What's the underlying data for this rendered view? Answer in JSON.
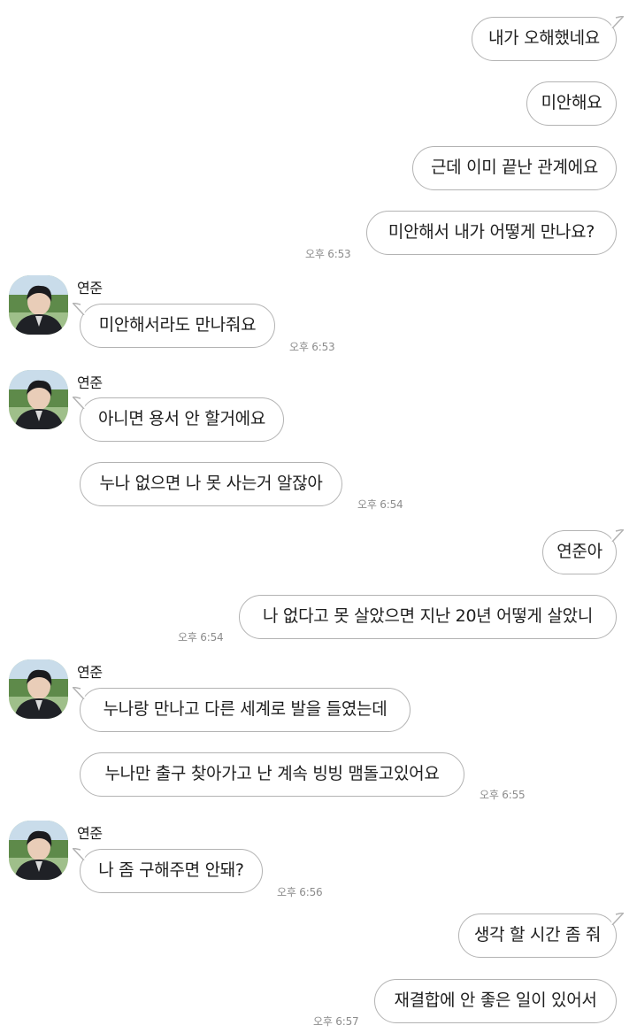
{
  "chat": {
    "sender_name": "연준",
    "messages": [
      {
        "text": "내가 오해했네요"
      },
      {
        "text": "미안해요"
      },
      {
        "text": "근데 이미 끝난 관계에요"
      },
      {
        "text": "미안해서 내가 어떻게 만나요?",
        "time": "오후 6:53"
      },
      {
        "text": "미안해서라도 만나줘요",
        "time": "오후 6:53"
      },
      {
        "text": "아니면 용서 안 할거에요"
      },
      {
        "text": "누나 없으면 나 못 사는거 알잖아",
        "time": "오후 6:54"
      },
      {
        "text": "연준아"
      },
      {
        "text": "나 없다고 못 살았으면 지난 20년 어떻게 살았니",
        "time": "오후 6:54"
      },
      {
        "text": "누나랑 만나고 다른 세계로 발을 들였는데"
      },
      {
        "text": "누나만 출구 찾아가고 난 계속 빙빙 맴돌고있어요",
        "time": "오후 6:55"
      },
      {
        "text": "나 좀 구해주면 안돼?",
        "time": "오후 6:56"
      },
      {
        "text": "생각 할 시간 좀 줘"
      },
      {
        "text": "재결합에 안 좋은 일이 있어서",
        "time": "오후 6:57"
      }
    ]
  },
  "colors": {
    "bubble_border": "#b3b3b3",
    "bubble_fill": "#ffffff",
    "timestamp": "#8c8c8c",
    "background": "#ffffff"
  },
  "icons": {
    "avatar": "profile-photo-avatar"
  }
}
